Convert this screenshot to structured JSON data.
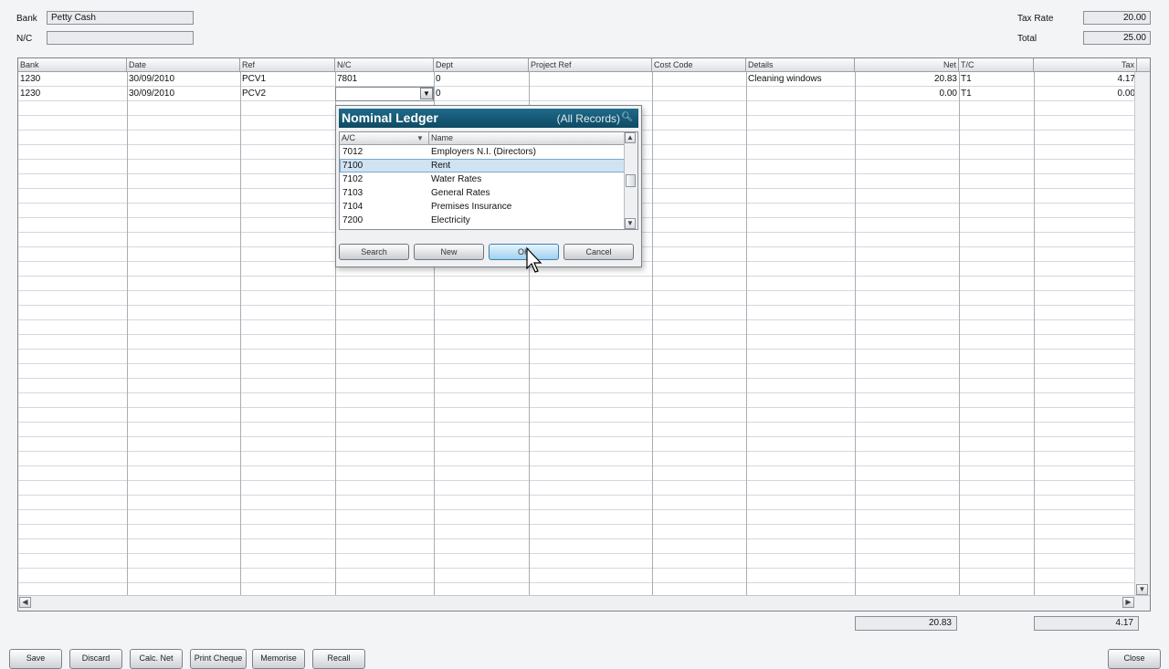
{
  "header": {
    "bank_label": "Bank",
    "bank_value": "Petty Cash",
    "nc_label": "N/C",
    "nc_value": "",
    "tax_rate_label": "Tax Rate",
    "tax_rate_value": "20.00",
    "total_label": "Total",
    "total_value": "25.00"
  },
  "grid": {
    "columns": [
      "Bank",
      "Date",
      "Ref",
      "N/C",
      "Dept",
      "Project Ref",
      "Cost Code",
      "Details",
      "Net",
      "T/C",
      "Tax"
    ],
    "rows": [
      {
        "bank": "1230",
        "date": "30/09/2010",
        "ref": "PCV1",
        "nc": "7801",
        "dept": "0",
        "project_ref": "",
        "cost_code": "",
        "details": "Cleaning windows",
        "net": "20.83",
        "tc": "T1",
        "tax": "4.17"
      },
      {
        "bank": "1230",
        "date": "30/09/2010",
        "ref": "PCV2",
        "nc": "",
        "dept": "0",
        "project_ref": "",
        "cost_code": "",
        "details": "",
        "net": "0.00",
        "tc": "T1",
        "tax": "0.00"
      }
    ]
  },
  "totals": {
    "net": "20.83",
    "tax": "4.17"
  },
  "footer_buttons": [
    "Save",
    "Discard",
    "Calc. Net",
    "Print Cheque",
    "Memorise",
    "Recall"
  ],
  "close_button": "Close",
  "dialog": {
    "title": "Nominal Ledger",
    "subtitle": "(All Records)",
    "col_ac": "A/C",
    "col_name": "Name",
    "items": [
      {
        "ac": "7012",
        "name": "Employers N.I. (Directors)"
      },
      {
        "ac": "7100",
        "name": "Rent"
      },
      {
        "ac": "7102",
        "name": "Water Rates"
      },
      {
        "ac": "7103",
        "name": "General Rates"
      },
      {
        "ac": "7104",
        "name": "Premises Insurance"
      },
      {
        "ac": "7200",
        "name": "Electricity"
      }
    ],
    "selected_index": 1,
    "buttons": {
      "search": "Search",
      "new": "New",
      "ok": "OK",
      "cancel": "Cancel"
    }
  },
  "icons": {
    "dropdown": "chevron-down-icon",
    "dialog_search": "magnifier-icon",
    "cursor": "mouse-pointer-icon"
  }
}
